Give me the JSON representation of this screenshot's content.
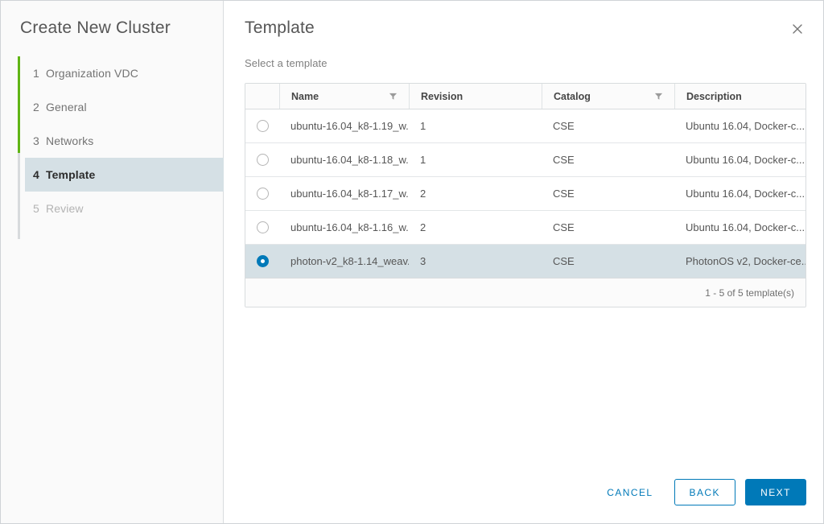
{
  "wizard": {
    "title": "Create New Cluster",
    "steps": [
      {
        "num": "1",
        "label": "Organization VDC",
        "state": "done"
      },
      {
        "num": "2",
        "label": "General",
        "state": "done"
      },
      {
        "num": "3",
        "label": "Networks",
        "state": "done"
      },
      {
        "num": "4",
        "label": "Template",
        "state": "active"
      },
      {
        "num": "5",
        "label": "Review",
        "state": "disabled"
      }
    ]
  },
  "content": {
    "title": "Template",
    "subtitle": "Select a template",
    "close_icon": "close-icon"
  },
  "table": {
    "columns": [
      {
        "label": "Name",
        "filter": true
      },
      {
        "label": "Revision",
        "filter": false
      },
      {
        "label": "Catalog",
        "filter": true
      },
      {
        "label": "Description",
        "filter": false
      }
    ],
    "rows": [
      {
        "selected": false,
        "name": "ubuntu-16.04_k8-1.19_w...",
        "revision": "1",
        "catalog": "CSE",
        "description": "Ubuntu 16.04, Docker-c..."
      },
      {
        "selected": false,
        "name": "ubuntu-16.04_k8-1.18_w...",
        "revision": "1",
        "catalog": "CSE",
        "description": "Ubuntu 16.04, Docker-c..."
      },
      {
        "selected": false,
        "name": "ubuntu-16.04_k8-1.17_w...",
        "revision": "2",
        "catalog": "CSE",
        "description": "Ubuntu 16.04, Docker-c..."
      },
      {
        "selected": false,
        "name": "ubuntu-16.04_k8-1.16_w...",
        "revision": "2",
        "catalog": "CSE",
        "description": "Ubuntu 16.04, Docker-c..."
      },
      {
        "selected": true,
        "name": "photon-v2_k8-1.14_weav...",
        "revision": "3",
        "catalog": "CSE",
        "description": "PhotonOS v2, Docker-ce..."
      }
    ],
    "pagination": "1 - 5 of 5 template(s)"
  },
  "actions": {
    "cancel": "CANCEL",
    "back": "BACK",
    "next": "NEXT"
  },
  "colors": {
    "accent": "#0079b8",
    "progress_green": "#60b515",
    "selected_row": "#d5e0e5"
  }
}
